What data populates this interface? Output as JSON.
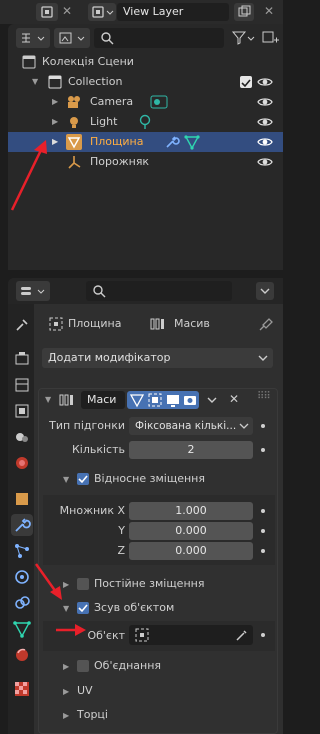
{
  "top_bar": {
    "view_layer_label": "View Layer"
  },
  "outliner": {
    "search_placeholder": "",
    "rows": [
      {
        "label": "Колекція Сцени"
      },
      {
        "label": "Collection"
      },
      {
        "label": "Camera"
      },
      {
        "label": "Light"
      },
      {
        "label": "Площина"
      },
      {
        "label": "Порожняк"
      }
    ]
  },
  "properties": {
    "search_placeholder": "",
    "breadcrumb": {
      "object": "Площина",
      "modifier": "Масив"
    },
    "add_modifier_label": "Додати модифікатор",
    "modifier": {
      "name": "Маси",
      "fit_type_label": "Тип підгонки",
      "fit_type_value": "Фіксована кількі...",
      "count_label": "Кількість",
      "count_value": "2",
      "relative_offset_label": "Відносне зміщення",
      "factor_x_label": "Множник X",
      "factor_x_value": "1.000",
      "y_label": "Y",
      "y_value": "0.000",
      "z_label": "Z",
      "z_value": "0.000",
      "constant_offset_label": "Постійне зміщення",
      "object_offset_label": "Зсув об'єктом",
      "object_label": "Об'єкт",
      "merge_label": "Об'єднання",
      "uv_label": "UV",
      "caps_label": "Торці"
    }
  },
  "colors": {
    "accent_blue": "#4772b3",
    "selection_row": "#334d80",
    "annotation_red": "#e8202a"
  }
}
